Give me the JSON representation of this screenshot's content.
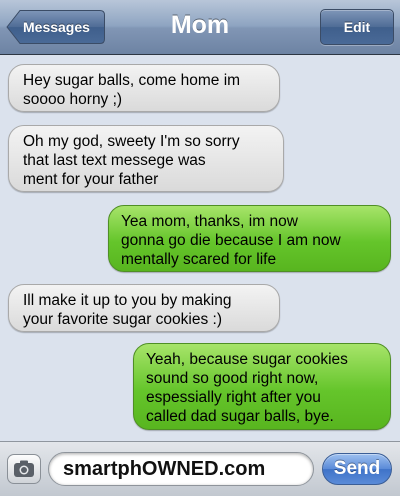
{
  "navbar": {
    "title": "Mom",
    "back_label": "Messages",
    "edit_label": "Edit"
  },
  "messages": [
    {
      "direction": "incoming",
      "text": "Hey sugar balls, come home im\nsoooo horny ;)"
    },
    {
      "direction": "incoming",
      "text": "Oh my god, sweety I'm so sorry\nthat last text messege was\nment for your father"
    },
    {
      "direction": "outgoing",
      "text": "Yea mom, thanks, im now\ngonna go die because I am now\nmentally scared for life"
    },
    {
      "direction": "incoming",
      "text": "Ill make it up to you by making\nyour favorite sugar cookies :)"
    },
    {
      "direction": "outgoing",
      "text": "Yeah, because sugar cookies\nsound so good right now,\nespessially right after you\ncalled dad sugar balls, bye."
    }
  ],
  "composer": {
    "field_value": "smartphOWNED.com",
    "send_label": "Send",
    "camera_icon": "camera-icon"
  },
  "colors": {
    "incoming_bubble": "#e6e6e6",
    "outgoing_bubble": "#65c52b",
    "background": "#dbe2ed",
    "navbar": "#8196b5"
  }
}
